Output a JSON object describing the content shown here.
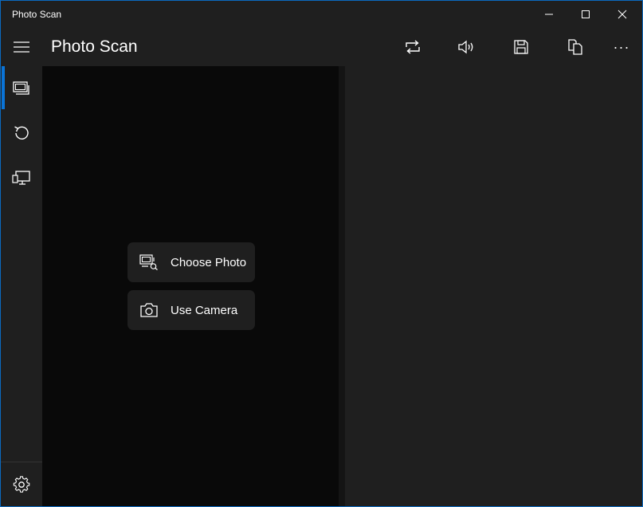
{
  "window": {
    "title": "Photo Scan",
    "accent": "#0b6ac0"
  },
  "caption_buttons": [
    {
      "name": "minimize-button",
      "icon": "minimize-icon"
    },
    {
      "name": "maximize-button",
      "icon": "maximize-icon"
    },
    {
      "name": "close-button",
      "icon": "close-icon"
    }
  ],
  "appbar": {
    "title": "Photo Scan",
    "menu_icon": "hamburger-icon",
    "commands": [
      {
        "name": "rotate-button",
        "icon": "rotate-icon"
      },
      {
        "name": "speak-button",
        "icon": "speaker-icon"
      },
      {
        "name": "save-button",
        "icon": "save-icon"
      },
      {
        "name": "copy-button",
        "icon": "copy-icon"
      }
    ],
    "more_label": "···"
  },
  "nav": {
    "items": [
      {
        "name": "nav-scan",
        "icon": "photo-scan-icon",
        "selected": true
      },
      {
        "name": "nav-history",
        "icon": "history-icon",
        "selected": false
      },
      {
        "name": "nav-project",
        "icon": "project-screen-icon",
        "selected": false
      }
    ],
    "settings_icon": "gear-icon",
    "selected_color": "#0a74d8"
  },
  "actions": {
    "choose_photo": "Choose Photo",
    "use_camera": "Use Camera"
  }
}
